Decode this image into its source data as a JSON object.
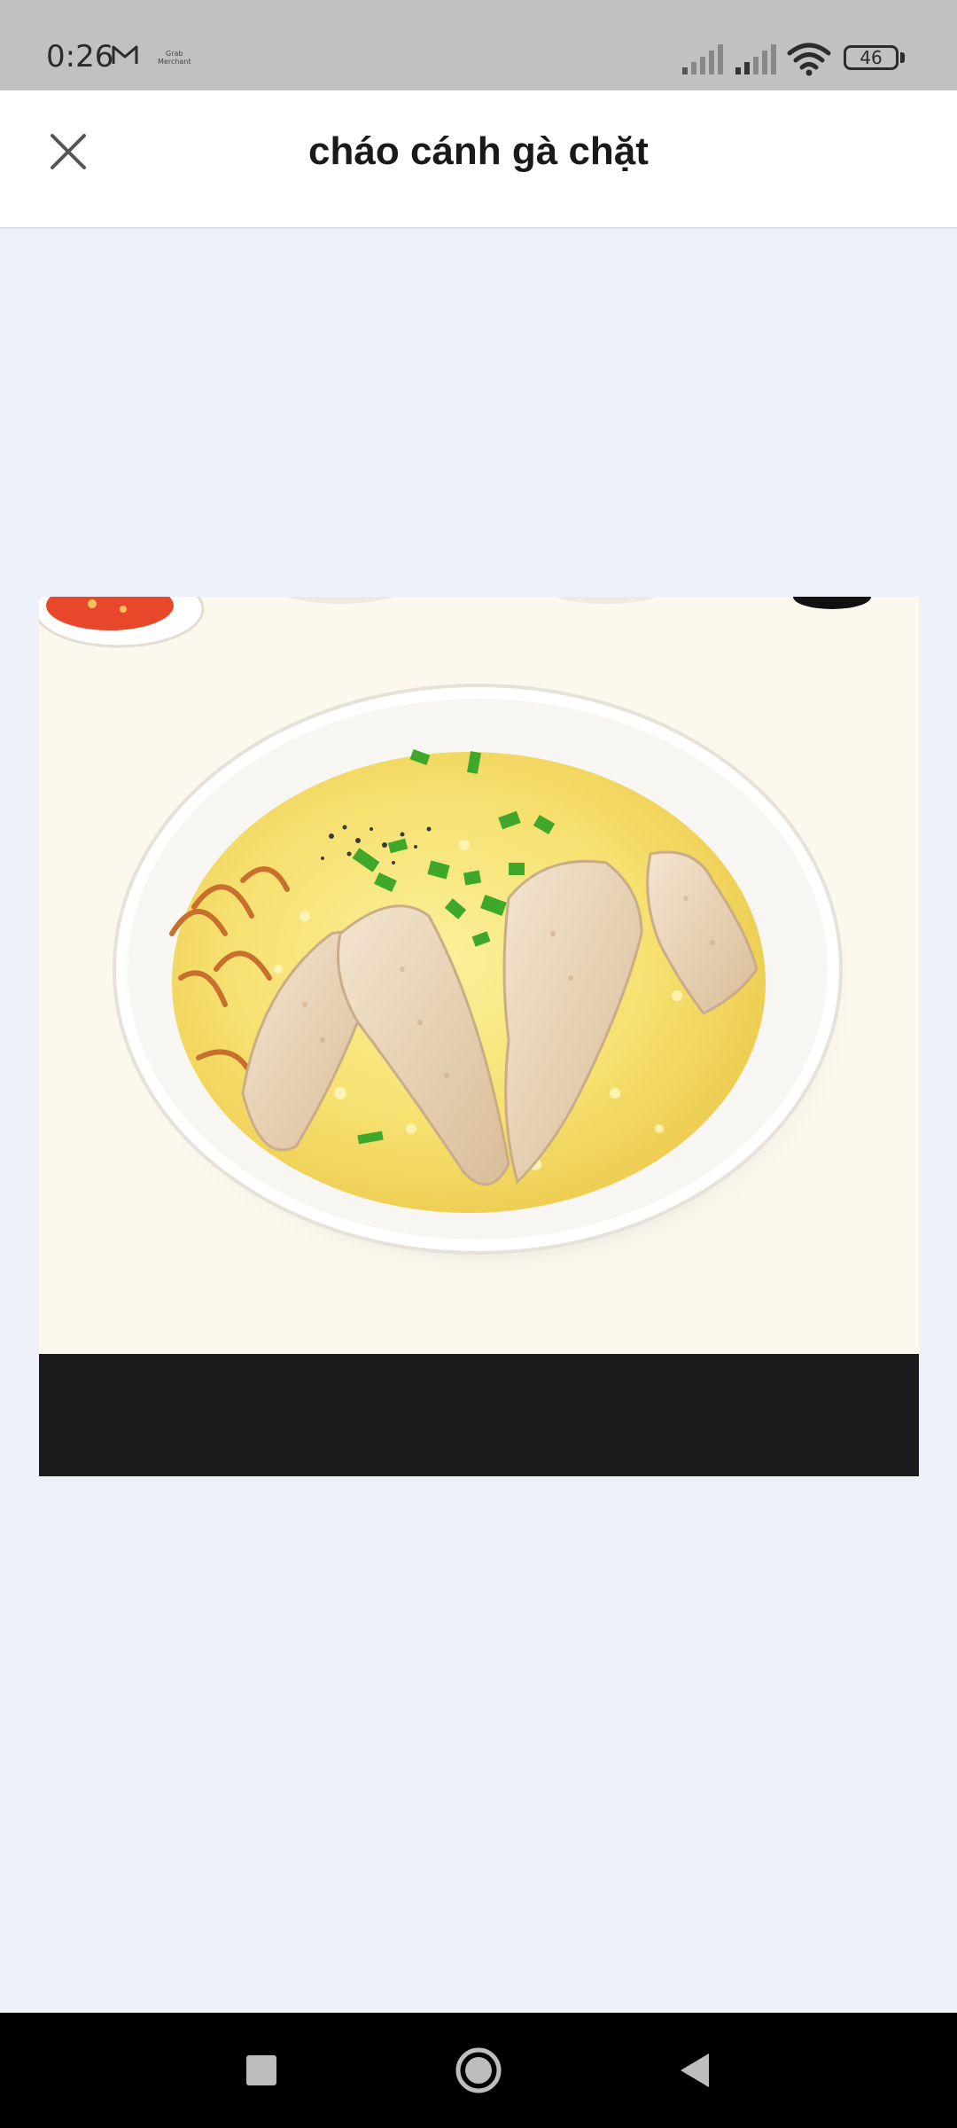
{
  "status_bar": {
    "time": "0:26",
    "notification_app_line1": "Grab",
    "notification_app_line2": "Merchant",
    "battery_level": "46",
    "icons": [
      "gmail-icon",
      "signal-icon",
      "signal-icon",
      "wifi-icon",
      "battery-icon"
    ]
  },
  "header": {
    "title": "cháo cánh gà chặt",
    "close_icon": "close-icon"
  },
  "image": {
    "subject": "chicken-wing-porridge-photo"
  },
  "nav_bar": {
    "icons": [
      "recent-apps-icon",
      "home-icon",
      "back-icon"
    ]
  }
}
